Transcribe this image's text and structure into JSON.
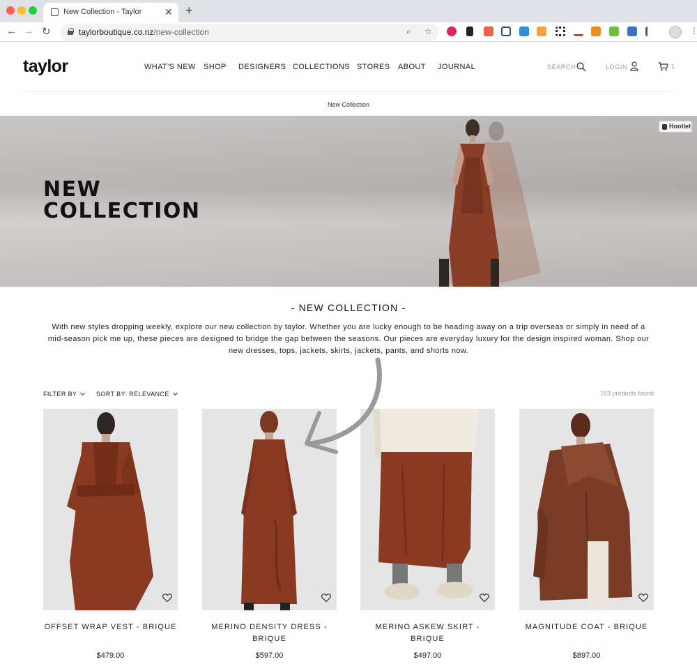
{
  "browser": {
    "tab_title": "New Collection - Taylor",
    "url_domain": "taylorboutique.co.nz",
    "url_path": "/new-collection"
  },
  "header": {
    "logo": "taylor",
    "nav": [
      "WHAT'S NEW",
      "SHOP",
      "DESIGNERS",
      "COLLECTIONS",
      "STORES",
      "ABOUT",
      "JOURNAL"
    ],
    "search_label": "SEARCH",
    "login_label": "LOGIN",
    "cart_count": "1",
    "breadcrumb": "New Collection"
  },
  "hero": {
    "title_line1": "NEW",
    "title_line2": "COLLECTION",
    "hootlet": "Hootlet"
  },
  "intro": {
    "heading": "- NEW COLLECTION -",
    "body": "With new styles dropping weekly, explore our new collection by taylor. Whether you are lucky enough to be heading away on a trip overseas or simply in need of a mid-season pick me up, these pieces are designed to bridge the gap between the seasons. Our pieces are everyday luxury for the design inspired woman. Shop our new dresses, tops, jackets, skirts, jackets, pants, and shorts now."
  },
  "filters": {
    "filter_label": "FILTER BY",
    "sort_label": "SORT BY: RELEVANCE",
    "count": "163 products found"
  },
  "products": [
    {
      "name": "OFFSET WRAP VEST - BRIQUE",
      "price": "$479.00"
    },
    {
      "name": "MERINO DENSITY DRESS - BRIQUE",
      "price": "$597.00"
    },
    {
      "name": "MERINO ASKEW SKIRT - BRIQUE",
      "price": "$497.00"
    },
    {
      "name": "MAGNITUDE COAT - BRIQUE",
      "price": "$897.00"
    }
  ],
  "colors": {
    "brique": "#8a3a22",
    "brique_dark": "#6e2c18",
    "coat": "#7a3c26",
    "image_bg": "#e6e5e5"
  }
}
